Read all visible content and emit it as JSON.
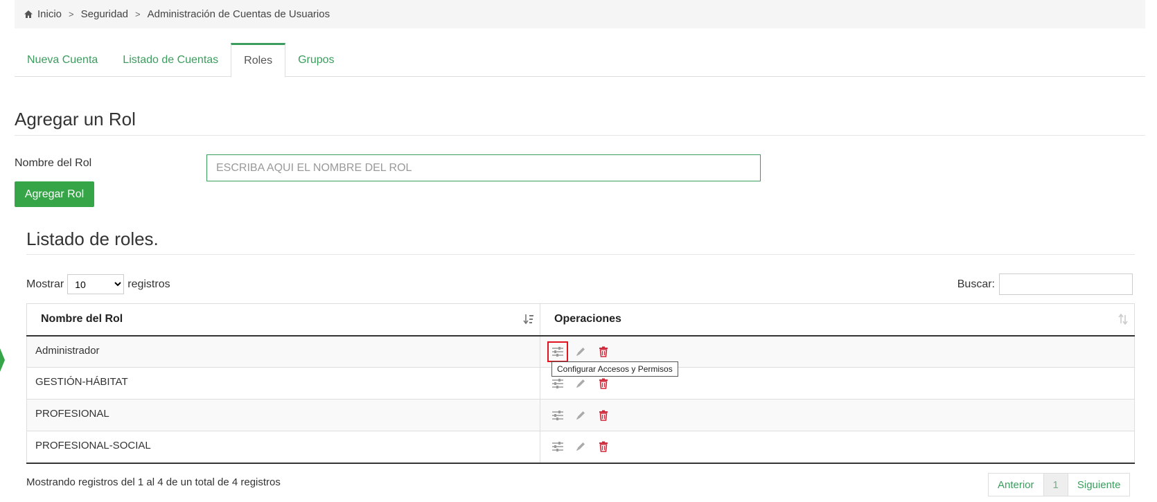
{
  "breadcrumb": {
    "home": "Inicio",
    "section": "Seguridad",
    "page": "Administración de Cuentas de Usuarios"
  },
  "tabs": [
    {
      "label": "Nueva Cuenta",
      "active": false
    },
    {
      "label": "Listado de Cuentas",
      "active": false
    },
    {
      "label": "Roles",
      "active": true
    },
    {
      "label": "Grupos",
      "active": false
    }
  ],
  "form": {
    "title": "Agregar un Rol",
    "field_label": "Nombre del Rol",
    "placeholder": "ESCRIBA AQUI EL NOMBRE DEL ROL",
    "button_label": "Agregar Rol"
  },
  "list": {
    "title": "Listado de roles.",
    "show_label": "Mostrar",
    "page_size": "10",
    "records_label": "registros",
    "search_label": "Buscar:",
    "columns": [
      "Nombre del Rol",
      "Operaciones"
    ],
    "rows": [
      {
        "name": "Administrador"
      },
      {
        "name": "GESTIÓN-HÁBITAT"
      },
      {
        "name": "PROFESIONAL"
      },
      {
        "name": "PROFESIONAL-SOCIAL"
      }
    ],
    "tooltip": "Configurar Accesos y Permisos",
    "summary": "Mostrando registros del 1 al 4 de un total de 4 registros",
    "pagination": {
      "prev": "Anterior",
      "current": "1",
      "next": "Siguiente"
    }
  },
  "icons": {
    "home": "home-icon",
    "sort_desc": "sort-alpha-desc-icon",
    "sort": "sort-icon",
    "configure": "sliders-icon",
    "edit": "pencil-icon",
    "delete": "trash-icon"
  },
  "colors": {
    "accent": "#3a9d5d",
    "button": "#35a548",
    "delete": "#d0283b",
    "highlight": "#e0141e"
  }
}
